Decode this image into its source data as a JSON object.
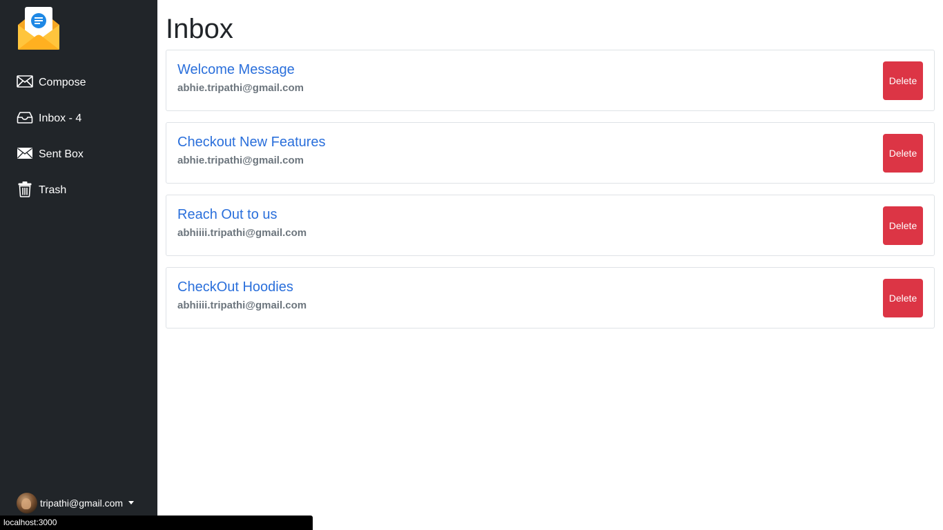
{
  "sidebar": {
    "logo_icon": "mail-envelope-logo-icon",
    "nav": [
      {
        "icon": "envelope-icon",
        "label": "Compose"
      },
      {
        "icon": "inbox-icon",
        "label": "Inbox - 4"
      },
      {
        "icon": "envelope-filled-icon",
        "label": "Sent Box"
      },
      {
        "icon": "trash-icon",
        "label": "Trash"
      }
    ],
    "user": {
      "email": "tripathi@gmail.com",
      "avatar_icon": "user-avatar"
    }
  },
  "main": {
    "title": "Inbox",
    "delete_label": "Delete",
    "emails": [
      {
        "subject": "Welcome Message",
        "from": "abhie.tripathi@gmail.com"
      },
      {
        "subject": "Checkout New Features",
        "from": "abhie.tripathi@gmail.com"
      },
      {
        "subject": "Reach Out to us",
        "from": "abhiiii.tripathi@gmail.com"
      },
      {
        "subject": "CheckOut Hoodies",
        "from": "abhiiii.tripathi@gmail.com"
      }
    ]
  },
  "status_bar": {
    "url": "localhost:3000"
  },
  "colors": {
    "sidebar_bg": "#212529",
    "link": "#2a6fdb",
    "danger": "#dc3545",
    "muted": "#6c757d"
  }
}
